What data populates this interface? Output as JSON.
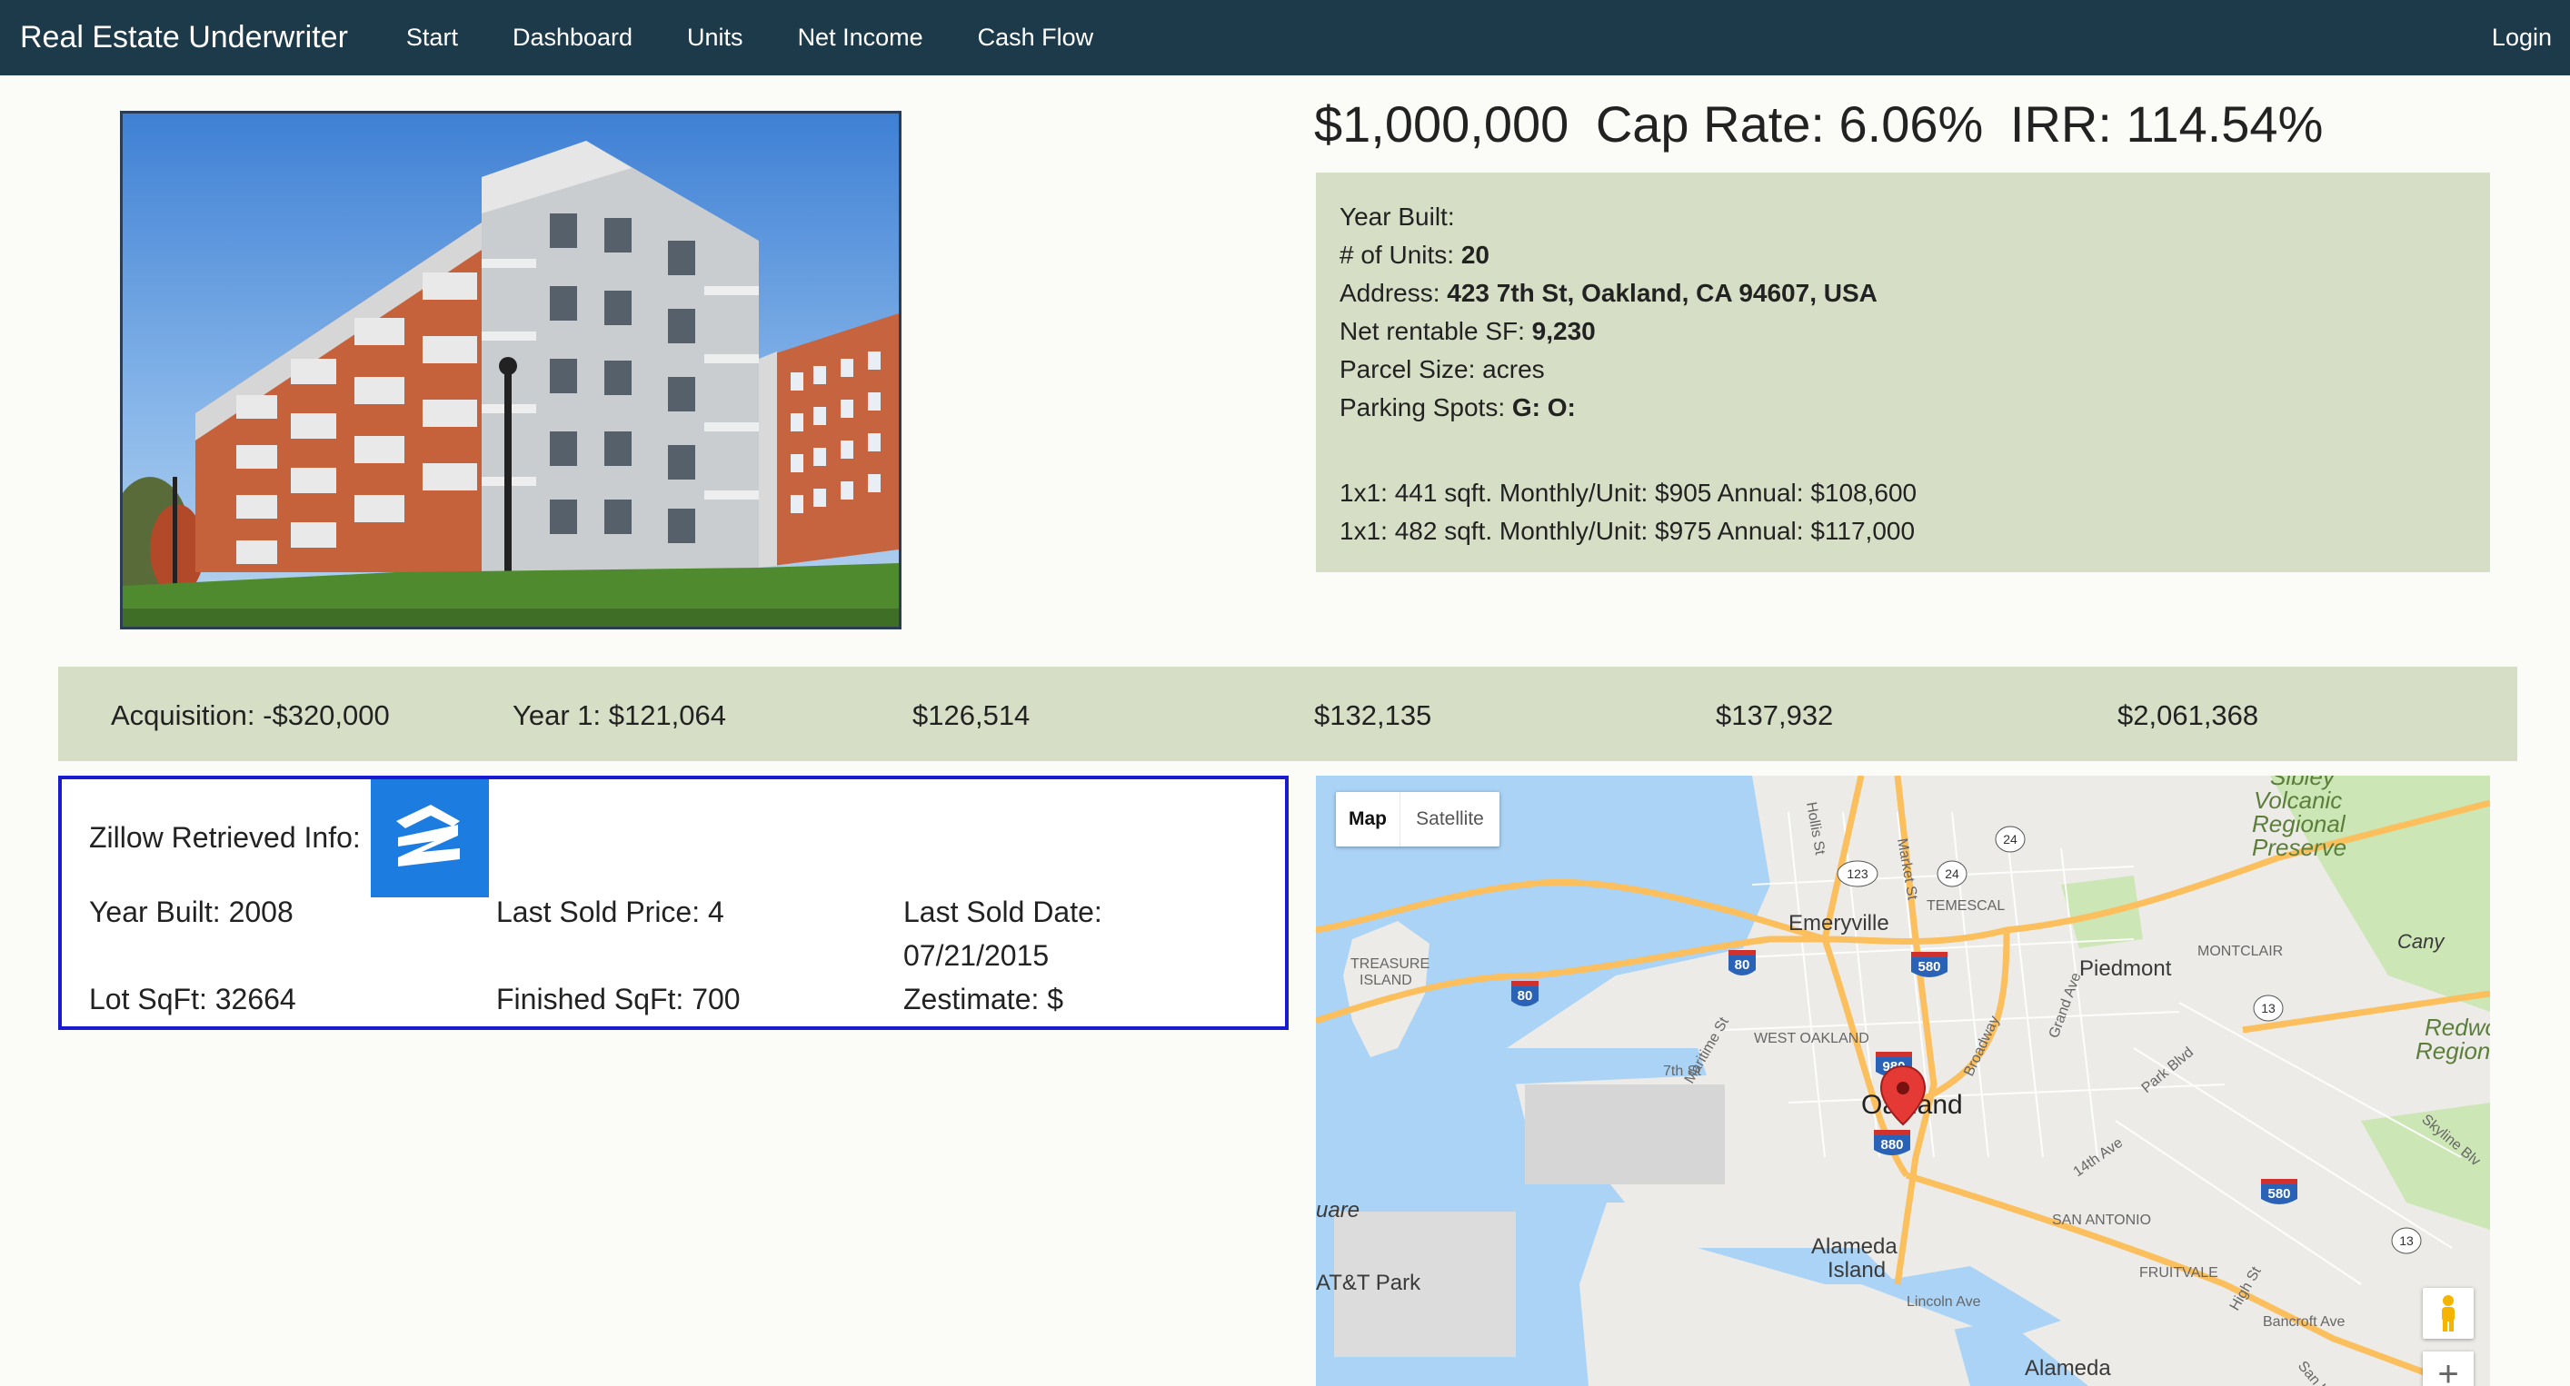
{
  "navbar": {
    "brand": "Real Estate Underwriter",
    "links": [
      "Start",
      "Dashboard",
      "Units",
      "Net Income",
      "Cash Flow"
    ],
    "login": "Login"
  },
  "headline": {
    "price": "$1,000,000",
    "cap_rate": "Cap Rate: 6.06%",
    "irr": "IRR: 114.54%"
  },
  "property": {
    "year_built_label": "Year Built:",
    "year_built_value": "",
    "units_label": "# of Units: ",
    "units_value": "20",
    "address_label": "Address: ",
    "address_value": "423 7th St, Oakland, CA 94607, USA",
    "sf_label": "Net rentable SF: ",
    "sf_value": "9,230",
    "parcel_label": "Parcel Size: acres",
    "parking_label": "Parking Spots: ",
    "parking_value": "G: O:",
    "unit_types": [
      "1x1: 441 sqft. Monthly/Unit: $905 Annual: $108,600",
      "1x1: 482 sqft. Monthly/Unit: $975 Annual: $117,000"
    ]
  },
  "cash_flow": [
    "Acquisition: -$320,000",
    "Year 1: $121,064",
    "$126,514",
    "$132,135",
    "$137,932",
    "$2,061,368"
  ],
  "zillow": {
    "title": "Zillow Retrieved Info:",
    "year_built": "Year Built: 2008",
    "last_sold_price": "Last Sold Price: 4",
    "last_sold_date_label": "Last Sold Date:",
    "last_sold_date": "07/21/2015",
    "lot_sqft": "Lot SqFt: 32664",
    "finished_sqft": "Finished SqFt: 700",
    "zestimate": "Zestimate: $"
  },
  "map": {
    "toggle_map": "Map",
    "toggle_satellite": "Satellite",
    "labels": {
      "emeryville": "Emeryville",
      "piedmont": "Piedmont",
      "oakland": "Oakland",
      "alameda_island_1": "Alameda",
      "alameda_island_2": "Island",
      "alameda": "Alameda",
      "treasure_island_1": "TREASURE",
      "treasure_island_2": "ISLAND",
      "west_oakland": "WEST OAKLAND",
      "temescal": "TEMESCAL",
      "montclair": "MONTCLAIR",
      "san_antonio": "SAN ANTONIO",
      "fruitvale": "FRUITVALE",
      "sibley_1": "Sibley",
      "sibley_2": "Volcanic",
      "sibley_3": "Regional",
      "sibley_4": "Preserve",
      "redwood_1": "Redwo",
      "redwood_2": "Regiona",
      "canyon": "Cany",
      "att_park": "AT&T Park",
      "square": "uare",
      "hollis": "Hollis St",
      "market": "Market St",
      "broadway": "Broadway",
      "grand_ave": "Grand Ave",
      "park_blvd": "Park Blvd",
      "ave_14th": "14th Ave",
      "high_st": "High St",
      "lincoln_ave": "Lincoln Ave",
      "bancroft_ave": "Bancroft Ave",
      "skyline": "Skyline Blv",
      "seventh_st": "7th St",
      "maritime": "Maritime St",
      "san_leandro": "San Leand"
    },
    "shields": {
      "i80": "80",
      "i580": "580",
      "i880": "880",
      "i980": "980",
      "r24": "24",
      "r123": "123",
      "r13": "13"
    },
    "colors": {
      "water": "#aad3f5",
      "land": "#ecebe7",
      "park": "#cde6b6",
      "highway": "#fbbf5e",
      "marker": "#e53935"
    }
  }
}
